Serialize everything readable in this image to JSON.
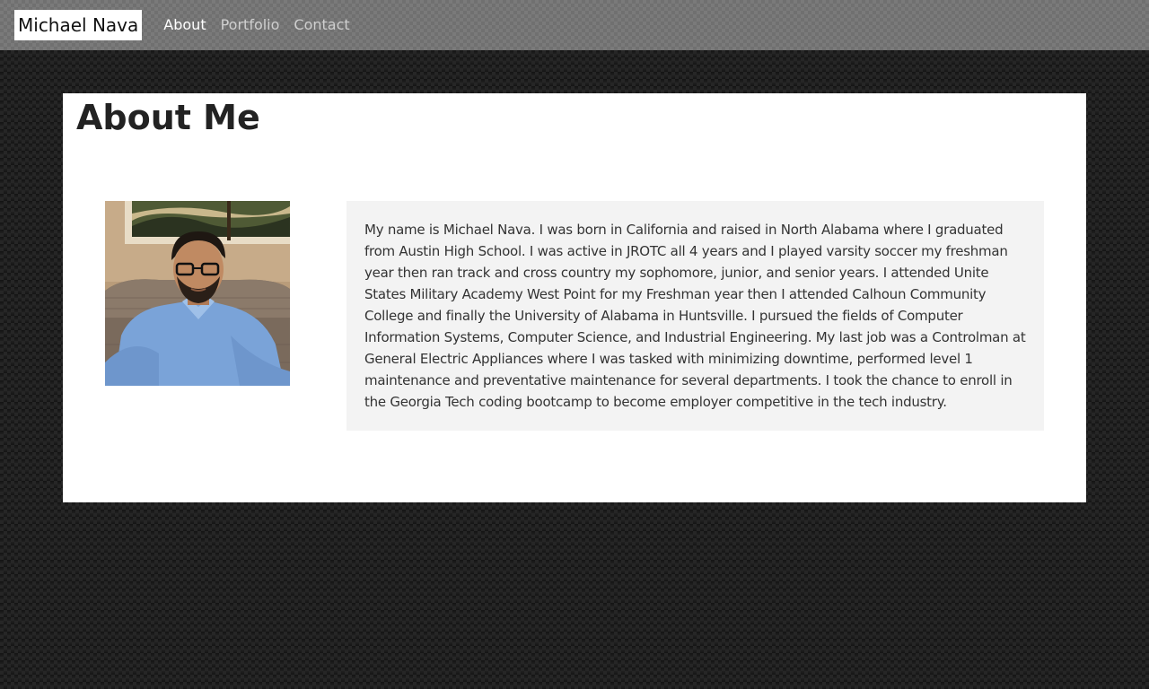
{
  "navbar": {
    "brand": "Michael Nava",
    "links": [
      {
        "label": "About",
        "active": true
      },
      {
        "label": "Portfolio",
        "active": false
      },
      {
        "label": "Contact",
        "active": false
      }
    ]
  },
  "main": {
    "title": "About Me",
    "bio": "My name is Michael Nava. I was born in California and raised in North Alabama where I graduated from Austin High School. I was active in JROTC all 4 years and I played varsity soccer my freshman year then ran track and cross country my sophomore, junior, and senior years. I attended Unite States Military Academy West Point for my Freshman year then I attended Calhoun Community College and finally the University of Alabama in Huntsville. I pursued the fields of Computer Information Systems, Computer Science, and Industrial Engineering. My last job was a Controlman at General Electric Appliances where I was tasked with minimizing downtime, performed level 1 maintenance and preventative maintenance for several departments. I took the chance to enroll in the Georgia Tech coding bootcamp to become employer competitive in the tech industry."
  },
  "colors": {
    "navbar": "#707070",
    "background": "#1c1c1c",
    "card": "#ffffff",
    "bio_box": "#f3f3f3"
  }
}
